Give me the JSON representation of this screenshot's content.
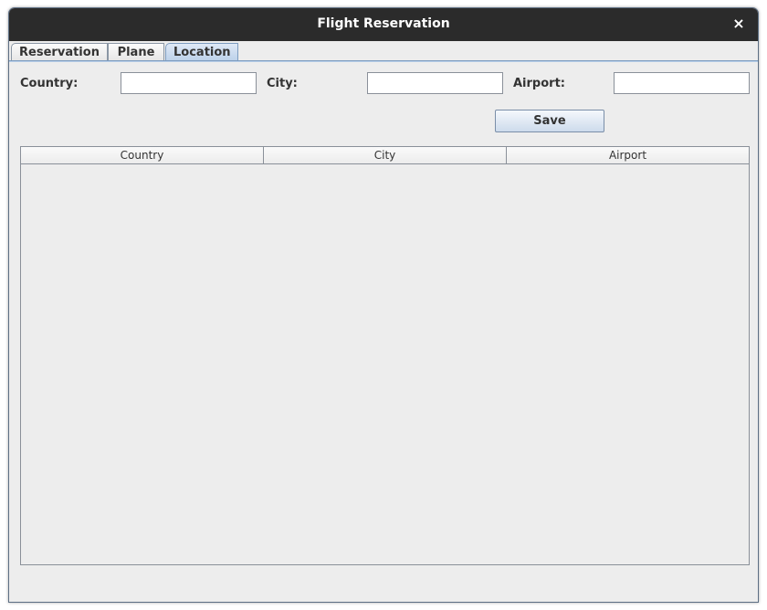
{
  "window": {
    "title": "Flight Reservation",
    "close_glyph": "×"
  },
  "tabs": [
    {
      "label": "Reservation",
      "active": false
    },
    {
      "label": "Plane",
      "active": false
    },
    {
      "label": "Location",
      "active": true
    }
  ],
  "form": {
    "country_label": "Country:",
    "country_value": "",
    "city_label": "City:",
    "city_value": "",
    "airport_label": "Airport:",
    "airport_value": "",
    "save_label": "Save"
  },
  "table": {
    "columns": [
      "Country",
      "City",
      "Airport"
    ],
    "rows": []
  },
  "colors": {
    "titlebar": "#2b2b2b",
    "panel": "#ededed",
    "active_tab": "#b9cfe9",
    "border": "#7d9cbf"
  }
}
